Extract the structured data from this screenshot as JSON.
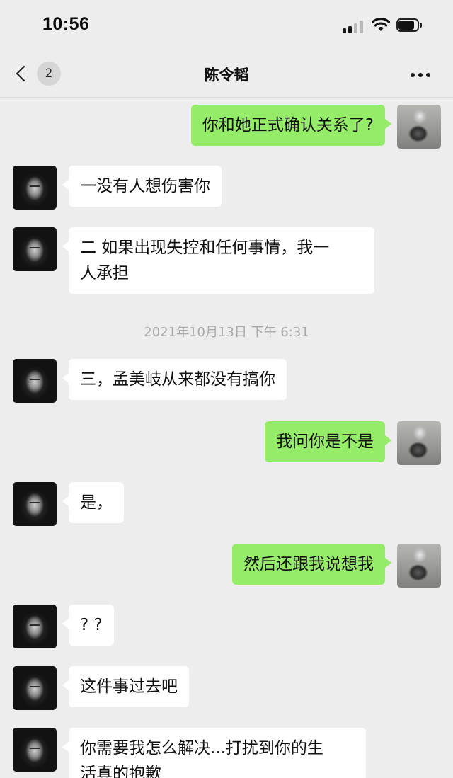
{
  "status_bar": {
    "time": "10:56",
    "icons": [
      "cellular-signal-icon",
      "wifi-icon",
      "battery-icon"
    ]
  },
  "nav": {
    "back_icon": "chevron-left-icon",
    "unread_count": "2",
    "title": "陈令韬",
    "more_icon": "more-dots-icon"
  },
  "colors": {
    "background": "#ededed",
    "incoming_bubble": "#ffffff",
    "outgoing_bubble": "#95ec69",
    "timestamp_text": "#a8a8a8"
  },
  "messages": [
    {
      "sender": "me",
      "text": "你和她正式确认关系了?"
    },
    {
      "sender": "contact",
      "text": "一没有人想伤害你"
    },
    {
      "sender": "contact",
      "lines": [
        "二 如果出现失控和任何事情，我一",
        "人承担"
      ]
    },
    {
      "sender": "contact",
      "text": "三，孟美岐从来都没有搞你"
    },
    {
      "sender": "me",
      "text": "我问你是不是"
    },
    {
      "sender": "contact",
      "text": "是，"
    },
    {
      "sender": "me",
      "text": "然后还跟我说想我"
    },
    {
      "sender": "contact",
      "text": "? ?"
    },
    {
      "sender": "contact",
      "text": "这件事过去吧"
    },
    {
      "sender": "contact",
      "lines": [
        "你需要我怎么解决...打扰到你的生",
        "活真的抱歉"
      ]
    }
  ],
  "timestamp": "2021年10月13日 下午 6:31"
}
